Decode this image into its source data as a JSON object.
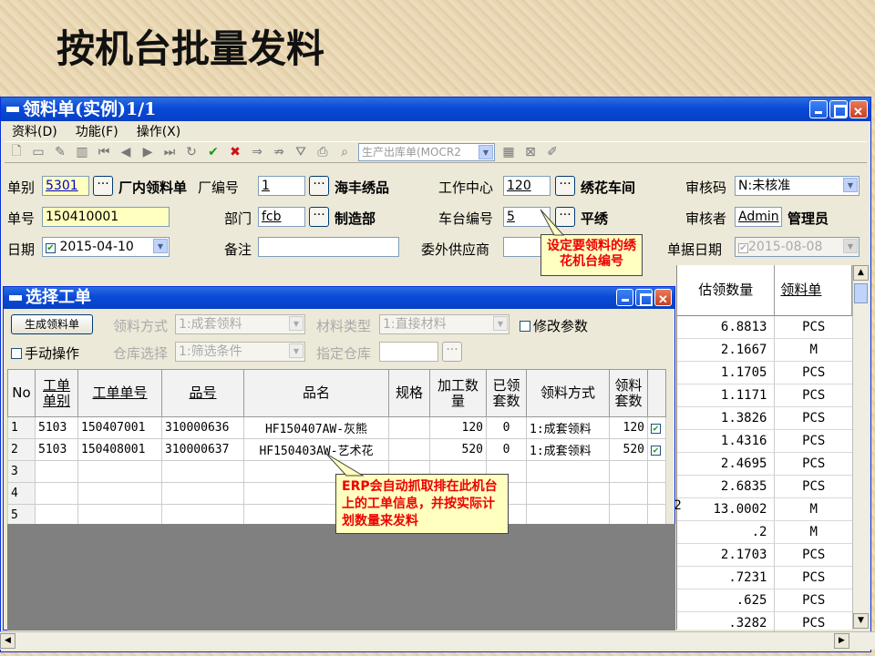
{
  "slide_title": "按机台批量发料",
  "main_window": {
    "title": "领料单(实例)1/1",
    "menu": [
      "资料(D)",
      "功能(F)",
      "操作(X)"
    ],
    "toolbar_select": "生产出库单(MOCR2"
  },
  "form": {
    "dan_bie_label": "单别",
    "dan_bie_value": "5301",
    "dan_bie_name": "厂内领料单",
    "factory_label": "厂编号",
    "factory_value": "1",
    "factory_name": "海丰绣品",
    "work_center_label": "工作中心",
    "work_center_value": "120",
    "work_center_name": "绣花车间",
    "audit_code_label": "审核码",
    "audit_code_value": "N:未核准",
    "dan_hao_label": "单号",
    "dan_hao_value": "150410001",
    "dept_label": "部门",
    "dept_value": "fcb",
    "dept_name": "制造部",
    "machine_label": "车台编号",
    "machine_value": "5",
    "machine_name": "平绣",
    "auditor_label": "审核者",
    "auditor_value": "Admin",
    "auditor_name": "管理员",
    "date_label": "日期",
    "date_value": "2015-04-10",
    "remark_label": "备注",
    "remark_value": "",
    "supplier_label": "委外供应商",
    "doc_date_label": "单据日期",
    "doc_date_value": "2015-08-08"
  },
  "callout_machine": "设定要领料的绣花机台编号",
  "callout_erp": "ERP会自动抓取排在此机台上的工单信息，并按实际计划数量来发料",
  "grid": {
    "col_qty": "估领数量",
    "col_unit": "领料单",
    "rows": [
      {
        "qty": "6.8813",
        "unit": "PCS"
      },
      {
        "qty": "2.1667",
        "unit": "M"
      },
      {
        "qty": "1.1705",
        "unit": "PCS"
      },
      {
        "qty": "1.1171",
        "unit": "PCS"
      },
      {
        "qty": "1.3826",
        "unit": "PCS"
      },
      {
        "qty": "1.4316",
        "unit": "PCS"
      },
      {
        "qty": "2.4695",
        "unit": "PCS"
      },
      {
        "qty": "2.6835",
        "unit": "PCS"
      },
      {
        "qty": "13.0002",
        "unit": "M"
      },
      {
        "qty": ".2",
        "unit": "M"
      },
      {
        "qty": "2.1703",
        "unit": "PCS"
      },
      {
        "qty": ".7231",
        "unit": "PCS"
      },
      {
        "qty": ".625",
        "unit": "PCS"
      },
      {
        "qty": ".3282",
        "unit": "PCS"
      }
    ]
  },
  "dialog": {
    "title": "选择工单",
    "generate_button": "生成领料单",
    "method_label": "领料方式",
    "method_value": "1:成套领料",
    "material_type_label": "材料类型",
    "material_type_value": "1:直接材料",
    "modify_params_label": "修改参数",
    "manual_label": "手动操作",
    "warehouse_select_label": "仓库选择",
    "warehouse_select_value": "1:筛选条件",
    "assigned_warehouse_label": "指定仓库",
    "columns": [
      "No",
      "工单单别",
      "工单单号",
      "品号",
      "品名",
      "规格",
      "加工数量",
      "已领套数",
      "领料方式",
      "领料套数"
    ],
    "rows": [
      {
        "no": "1",
        "type": "5103",
        "order": "150407001",
        "item": "310000636",
        "name": "HF150407AW-灰熊",
        "spec": "",
        "qty": "120",
        "received": "0",
        "method": "1:成套领料",
        "sets": "120"
      },
      {
        "no": "2",
        "type": "5103",
        "order": "150408001",
        "item": "310000637",
        "name": "HF150403AW-艺术花",
        "spec": "",
        "qty": "520",
        "received": "0",
        "method": "1:成套领料",
        "sets": "520"
      },
      {
        "no": "3",
        "type": "",
        "order": "",
        "item": "",
        "name": "",
        "spec": "",
        "qty": "",
        "received": "",
        "method": "",
        "sets": ""
      },
      {
        "no": "4",
        "type": "",
        "order": "",
        "item": "",
        "name": "",
        "spec": "",
        "qty": "",
        "received": "",
        "method": "",
        "sets": ""
      },
      {
        "no": "5",
        "type": "",
        "order": "",
        "item": "",
        "name": "",
        "spec": "",
        "qty": "",
        "received": "",
        "method": "",
        "sets": ""
      }
    ]
  },
  "grid_row9_marker": "2"
}
